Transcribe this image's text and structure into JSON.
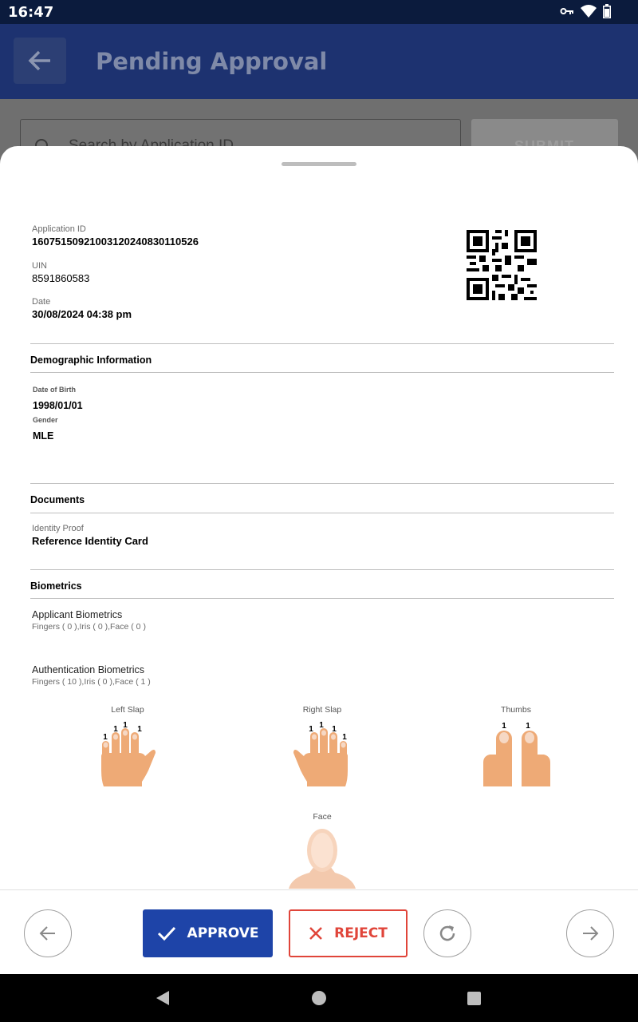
{
  "status_bar": {
    "time": "16:47"
  },
  "app_bar": {
    "title": "Pending Approval"
  },
  "search": {
    "placeholder": "Search by Application ID",
    "submit_label": "SUBMIT"
  },
  "application": {
    "application_id_label": "Application ID",
    "application_id": "16075150921003120240830110526",
    "uin_label": "UIN",
    "uin": "8591860583",
    "date_label": "Date",
    "date": "30/08/2024 04:38 pm"
  },
  "demographic": {
    "title": "Demographic Information",
    "dob_label": "Date of Birth",
    "dob": "1998/01/01",
    "gender_label": "Gender",
    "gender": "MLE"
  },
  "documents": {
    "title": "Documents",
    "identity_proof_label": "Identity Proof",
    "identity_proof": "Reference Identity Card"
  },
  "biometrics": {
    "title": "Biometrics",
    "applicant_title": "Applicant Biometrics",
    "applicant_summary": "Fingers ( 0 ),Iris ( 0 ),Face ( 0 )",
    "auth_title": "Authentication Biometrics",
    "auth_summary": "Fingers ( 10 ),Iris ( 0 ),Face ( 1 )",
    "left_slap_label": "Left Slap",
    "right_slap_label": "Right Slap",
    "thumbs_label": "Thumbs",
    "face_label": "Face",
    "left_slap_counts": [
      "1",
      "1",
      "1",
      "1"
    ],
    "right_slap_counts": [
      "1",
      "1",
      "1",
      "1"
    ],
    "thumb_counts": [
      "1",
      "1"
    ]
  },
  "actions": {
    "approve_label": "APPROVE",
    "reject_label": "REJECT"
  },
  "colors": {
    "primary": "#1e44a8",
    "reject": "#e0453a",
    "skin": "#eeaa76"
  }
}
